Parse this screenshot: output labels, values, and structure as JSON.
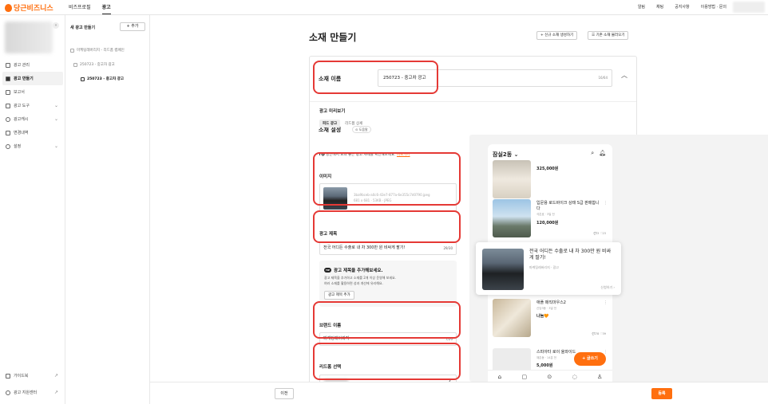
{
  "brand": {
    "logo_text": "당근비즈니스",
    "accent": "#ff6f0f"
  },
  "topnav": {
    "items": [
      "비즈프로필",
      "광고"
    ],
    "active": "광고"
  },
  "topright": {
    "items": [
      "알림",
      "채팅",
      "공지사항",
      "이용방법 · 문의"
    ]
  },
  "sidebar": {
    "items": [
      {
        "label": "광고 관리",
        "icon": "megaphone-icon"
      },
      {
        "label": "광고 만들기",
        "icon": "plus-square-icon",
        "active": true
      },
      {
        "label": "보고서",
        "icon": "report-icon"
      },
      {
        "label": "광고 도구",
        "icon": "tool-icon",
        "expand": true
      },
      {
        "label": "광고캐시",
        "icon": "cash-icon",
        "expand": true
      },
      {
        "label": "변경내역",
        "icon": "history-icon"
      },
      {
        "label": "설정",
        "icon": "gear-icon",
        "expand": true
      }
    ],
    "bottom": [
      {
        "label": "가이드북",
        "icon": "book-icon"
      },
      {
        "label": "광고 지원센터",
        "icon": "headset-icon"
      }
    ]
  },
  "tree": {
    "title": "새 광고 만들기",
    "add_label": "+ 추가",
    "items": [
      {
        "label": "마케팅레버리지 - 리드폼 캠페인"
      },
      {
        "label": "250723 - 중고차 광고"
      },
      {
        "label": "250723 - 중고차 광고"
      }
    ]
  },
  "page": {
    "title": "소재 만들기",
    "btn_new": "+ 신규 소재 생성하기",
    "btn_load": "기존 소재 불러오기"
  },
  "form": {
    "name_label": "소재 이름",
    "name_value": "250723 - 중고차 광고",
    "name_count": "16/64",
    "settings_title": "소재 설정",
    "help_label": "도움말",
    "tip_prefix": "Tip",
    "tip_text": "당근에서 효과 좋은 광고 사례를 확인해보세요.",
    "tip_link": "바로가기",
    "image_label": "이미지",
    "image_filename": "3ba9bceb-a0c6-43e7-877a-6e355c7d0790.jpeg",
    "image_meta": "681 x 681 · 53KB · JPEG",
    "title_label": "광고 제목",
    "title_value": "전국 어디든 수출로 내 차 300만 원 비싸게 팔기!",
    "title_count": "29/30",
    "promo_badge": "TIP",
    "promo_head": "광고 제목을 추가해보세요.",
    "promo_line1": "광고 제목을 추가하고 소재를 2개 이상 운영해 보세요.",
    "promo_line2": "여러 소재를 활용하면 성과 개선에 유리해요.",
    "promo_btn": "광고 제목 추가",
    "brand_label": "브랜드 이름",
    "brand_value": "마케팅레버리지",
    "brand_count": "7/20",
    "lead_label": "리드폼 선택"
  },
  "preview": {
    "title": "광고 미리보기",
    "tabs": [
      "피드 광고",
      "리드폼 상세"
    ],
    "location": "잠실2동",
    "items": [
      {
        "title": "",
        "price": "325,000원"
      },
      {
        "title": "입문용 로드바이크 상태 S급 판매합니다",
        "sub": "석촌호 · 3일 전",
        "price": "120,000원",
        "meta": "💬3 ♡23"
      },
      {
        "title": "애플 매직마우스2",
        "sub": "신당3동 · 3일 전",
        "price": "나눔🧡",
        "meta": "💬78 ♡39"
      },
      {
        "title": "스피아타 로이 울와이드",
        "sub": "재촌동 · 14분 전",
        "price": "5,000원",
        "meta": ""
      }
    ],
    "ad": {
      "title": "전국 어디든 수출로 내 차 300만 원 비싸게 팔기!",
      "brand": "마케팅레버리지 · 광고",
      "link": "신청하기 ›"
    },
    "fab": "+ 글쓰기"
  },
  "bottom": {
    "prev": "이전",
    "register": "등록"
  }
}
